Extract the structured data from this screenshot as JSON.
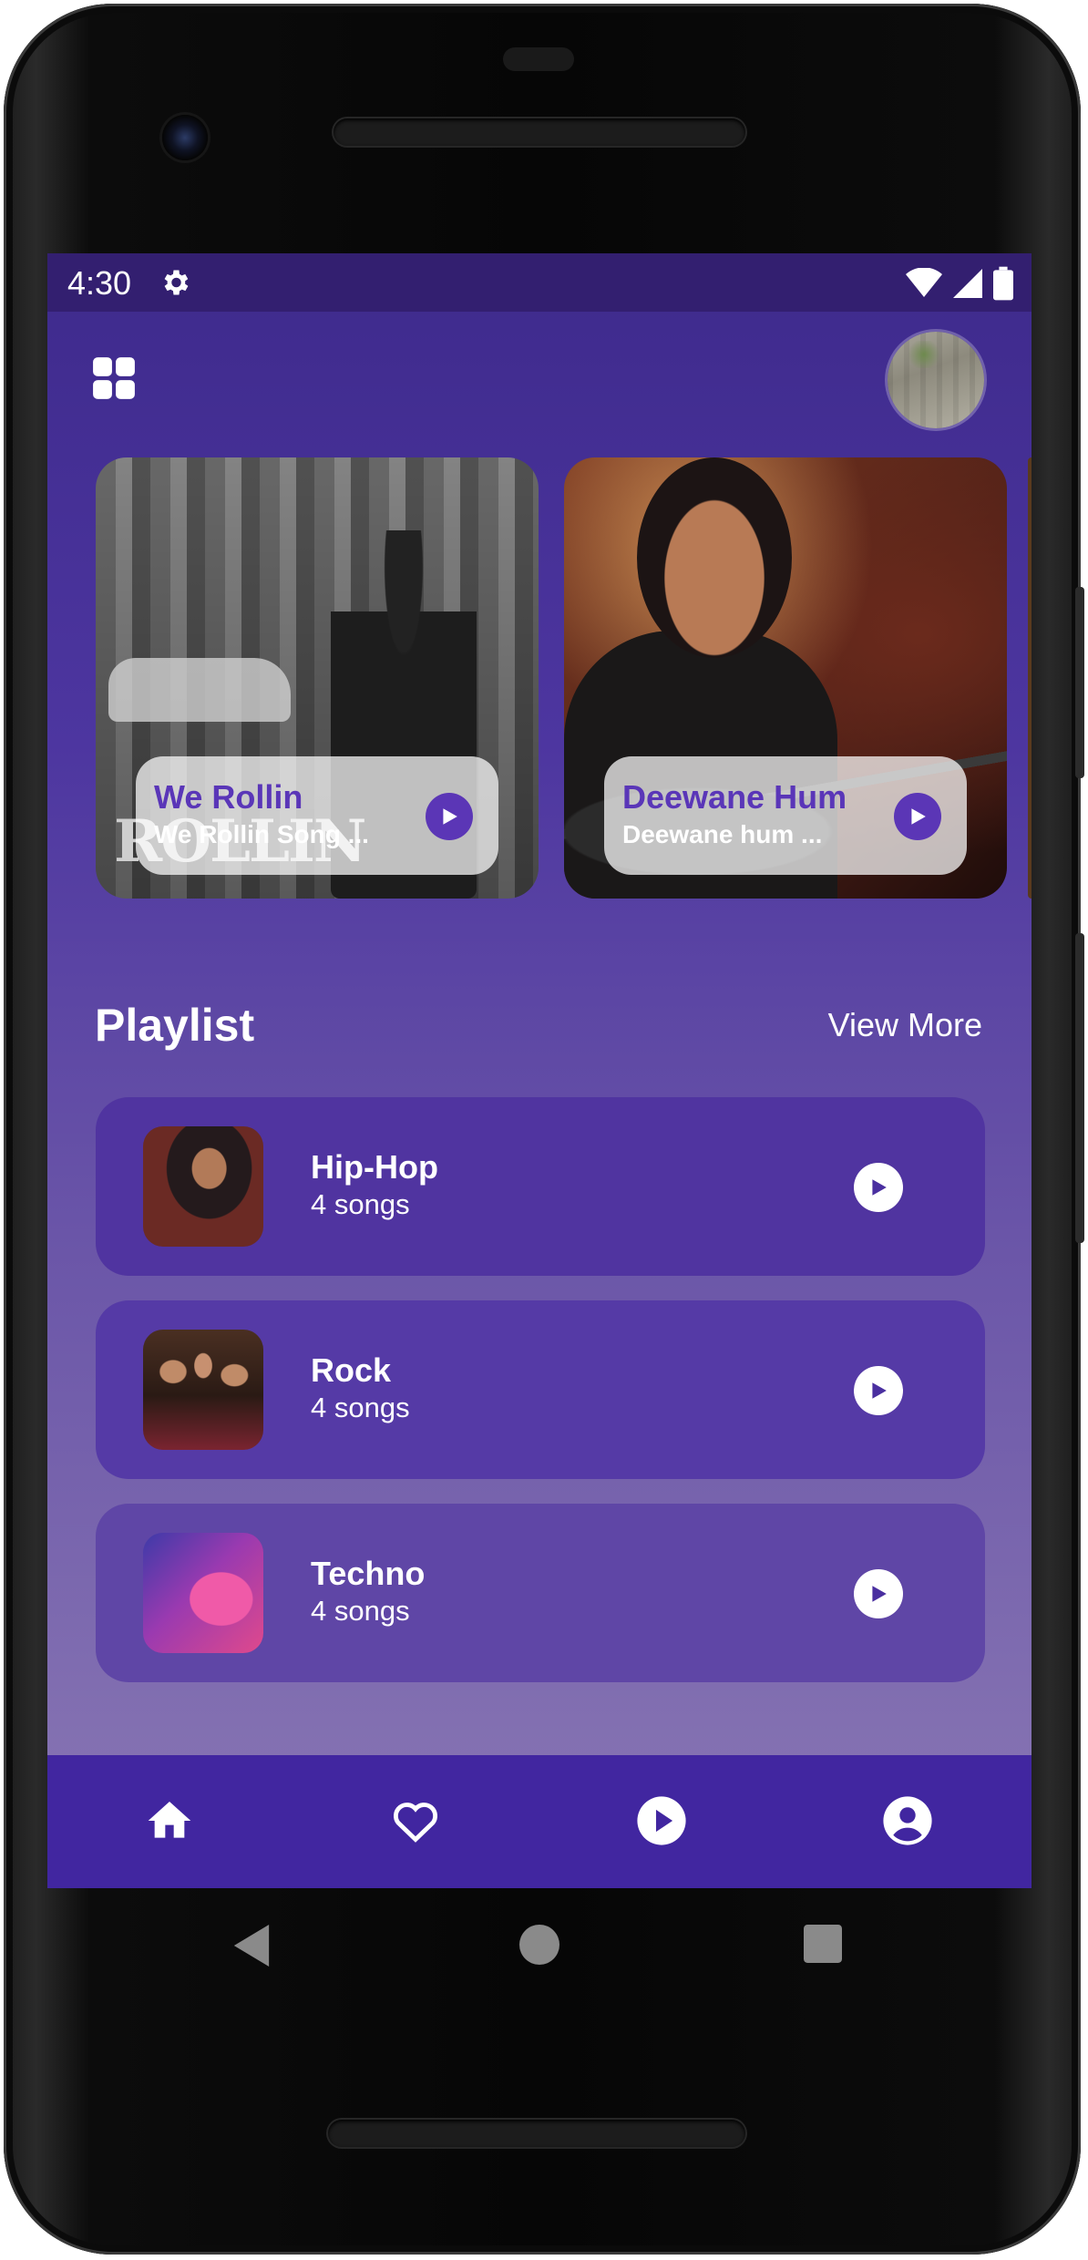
{
  "statusbar": {
    "time": "4:30",
    "icons": [
      "gear-icon",
      "wifi-icon",
      "signal-icon",
      "battery-icon"
    ]
  },
  "header": {
    "menu_icon": "grid-icon",
    "avatar": "profile-avatar"
  },
  "featured": [
    {
      "title": "We Rollin",
      "subtitle": "We Rollin Song ...",
      "logo_text": "ROLLIN"
    },
    {
      "title": "Deewane Hum",
      "subtitle": "Deewane hum ..."
    }
  ],
  "playlist": {
    "title": "Playlist",
    "view_more": "View More",
    "items": [
      {
        "name": "Hip-Hop",
        "count": "4 songs"
      },
      {
        "name": "Rock",
        "count": "4 songs"
      },
      {
        "name": "Techno",
        "count": "4 songs"
      }
    ]
  },
  "bottom_nav": [
    "home-icon",
    "heart-icon",
    "play-circle-icon",
    "account-icon"
  ],
  "colors": {
    "statusbar": "#331f70",
    "accent": "#5b36b6",
    "nav_bar": "#4126a0",
    "card": "#5034a0"
  }
}
